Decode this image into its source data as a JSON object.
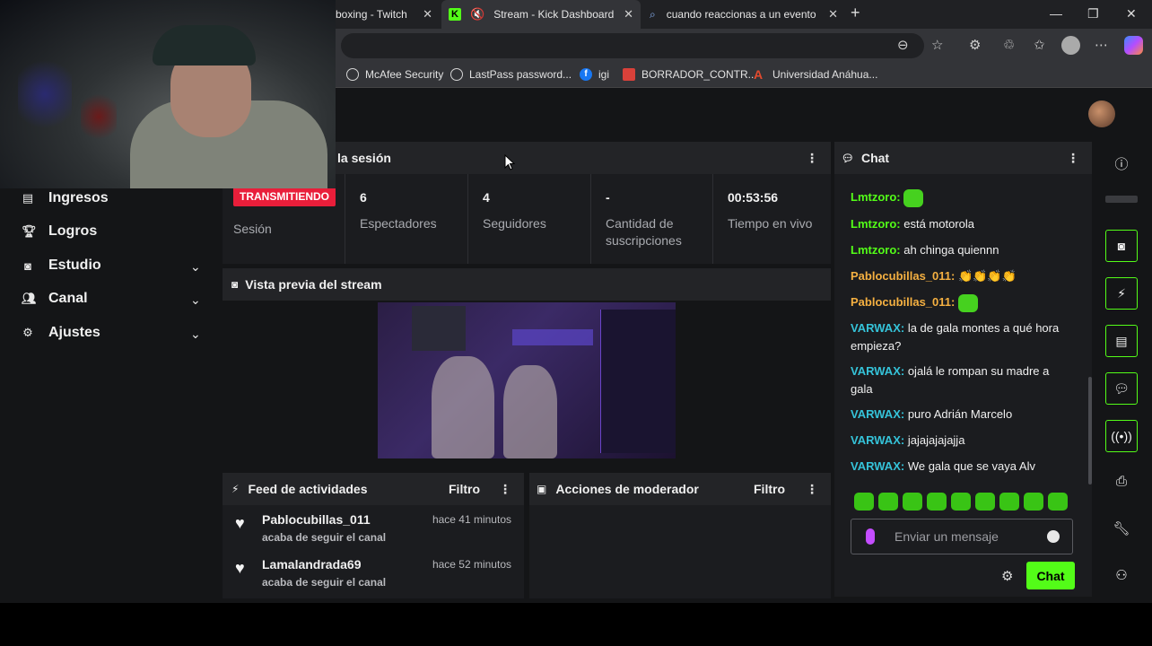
{
  "tabs": [
    {
      "title": "boxing - Twitch"
    },
    {
      "title": "Stream - Kick Dashboard"
    },
    {
      "title": "cuando reaccionas a un evento en"
    }
  ],
  "bookmarks": [
    "McAfee Security",
    "LastPass password...",
    "igi",
    "BORRADOR_CONTR...",
    "Universidad Anáhua..."
  ],
  "nav": [
    {
      "label": "Ingresos",
      "icon": "bar-chart-icon",
      "has_chevron": false
    },
    {
      "label": "Logros",
      "icon": "trophy-icon",
      "has_chevron": false
    },
    {
      "label": "Estudio",
      "icon": "camera-icon",
      "has_chevron": true
    },
    {
      "label": "Canal",
      "icon": "users-icon",
      "has_chevron": true
    },
    {
      "label": "Ajustes",
      "icon": "gear-icon",
      "has_chevron": true
    }
  ],
  "session": {
    "title": "la sesión",
    "badge": "TRANSMITIENDO",
    "badge_label": "Sesión",
    "stats": [
      {
        "value": "6",
        "label": "Espectadores"
      },
      {
        "value": "4",
        "label": "Seguidores"
      },
      {
        "value": "-",
        "label": "Cantidad de suscripciones"
      },
      {
        "value": "00:53:56",
        "label": "Tiempo en vivo"
      }
    ]
  },
  "preview": {
    "title": "Vista previa del stream"
  },
  "feed": {
    "title": "Feed de actividades",
    "filter": "Filtro",
    "items": [
      {
        "user": "Pablocubillas_011",
        "action": "acaba de seguir el canal",
        "time": "hace 41 minutos"
      },
      {
        "user": "Lamalandrada69",
        "action": "acaba de seguir el canal",
        "time": "hace 52 minutos"
      }
    ]
  },
  "mod": {
    "title": "Acciones de moderador",
    "filter": "Filtro"
  },
  "chat": {
    "title": "Chat",
    "messages": [
      {
        "user": "Lmtzoro:",
        "text": "",
        "emote": true,
        "color": "#53fc18"
      },
      {
        "user": "Lmtzoro:",
        "text": "está motorola",
        "emote": false,
        "color": "#53fc18"
      },
      {
        "user": "Lmtzoro:",
        "text": "ah chinga quiennn",
        "emote": false,
        "color": "#53fc18"
      },
      {
        "user": "Pablocubillas_011:",
        "text": "👏👏👏👏",
        "emote": false,
        "color": "#f5b041"
      },
      {
        "user": "Pablocubillas_011:",
        "text": "",
        "emote": true,
        "color": "#f5b041"
      },
      {
        "user": "VARWAX:",
        "text": "la de gala montes a qué hora empieza?",
        "emote": false,
        "color": "#35c3d9"
      },
      {
        "user": "VARWAX:",
        "text": "ojalá le rompan su madre a gala",
        "emote": false,
        "color": "#35c3d9"
      },
      {
        "user": "VARWAX:",
        "text": "puro Adrián Marcelo",
        "emote": false,
        "color": "#35c3d9"
      },
      {
        "user": "VARWAX:",
        "text": "jajajajajajja",
        "emote": false,
        "color": "#35c3d9"
      },
      {
        "user": "VARWAX:",
        "text": "We gala que se vaya Alv",
        "emote": false,
        "color": "#35c3d9"
      }
    ],
    "placeholder": "Enviar un mensaje",
    "send_label": "Chat"
  },
  "colors": {
    "accent": "#53fc18",
    "live": "#e91e3a"
  }
}
